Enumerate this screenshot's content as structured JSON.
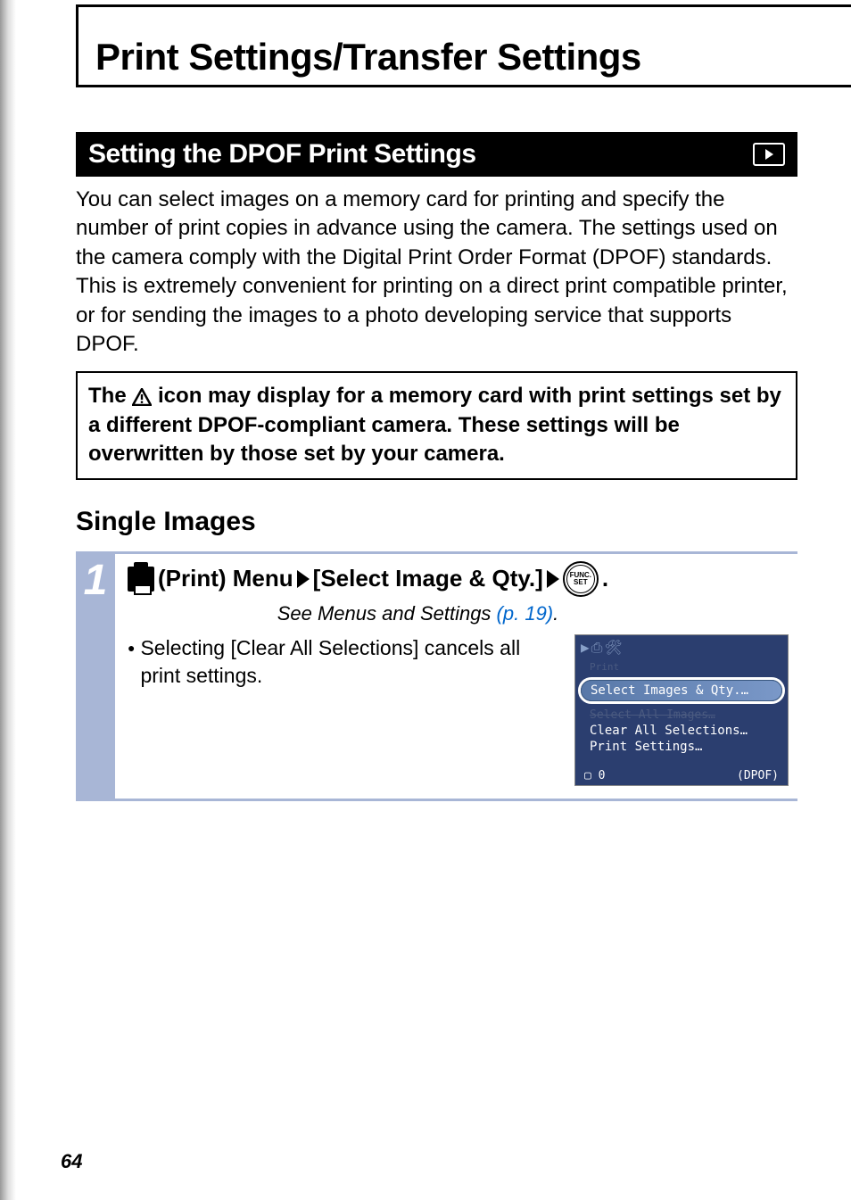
{
  "page": {
    "title": "Print Settings/Transfer Settings",
    "number": "64"
  },
  "section": {
    "title": "Setting the DPOF Print Settings"
  },
  "body": {
    "intro": "You can select images on a memory card for printing and specify the number of print copies in advance using the camera. The settings used on the camera comply with the Digital Print Order Format (DPOF) standards. This is extremely convenient for printing on a direct print compatible printer, or for sending the images to a photo developing service that supports DPOF."
  },
  "note": {
    "pre": "The ",
    "post": " icon may display for a memory card with print settings set by a different DPOF-compliant camera. These settings will be overwritten by those set by your camera."
  },
  "subheading": "Single Images",
  "step": {
    "num": "1",
    "print_menu_label": "(Print) Menu",
    "select_label": "[Select Image & Qty.]",
    "period": ".",
    "see_pre": "See Menus and Settings ",
    "see_link": "(p. 19)",
    "see_post": ".",
    "bullet": "Selecting [Clear All Selections] cancels all print settings.",
    "func_top": "FUNC.",
    "func_bottom": "SET"
  },
  "camera": {
    "highlighted": "Select Images & Qty.…",
    "faded": "Select All Images…",
    "clear": "Clear All Selections…",
    "settings": "Print Settings…",
    "footer_left": "▢ 0",
    "footer_right": "(DPOF)"
  }
}
